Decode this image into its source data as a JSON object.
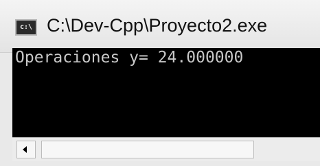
{
  "window": {
    "title": "C:\\Dev-Cpp\\Proyecto2.exe",
    "icon": "console-app-icon",
    "icon_text": "c:\\"
  },
  "console": {
    "lines": [
      "Operaciones y= 24.000000"
    ],
    "background": "#000000",
    "text_color": "#c8c8c8"
  },
  "scrollbar": {
    "left_button_icon": "left-arrow-icon"
  }
}
